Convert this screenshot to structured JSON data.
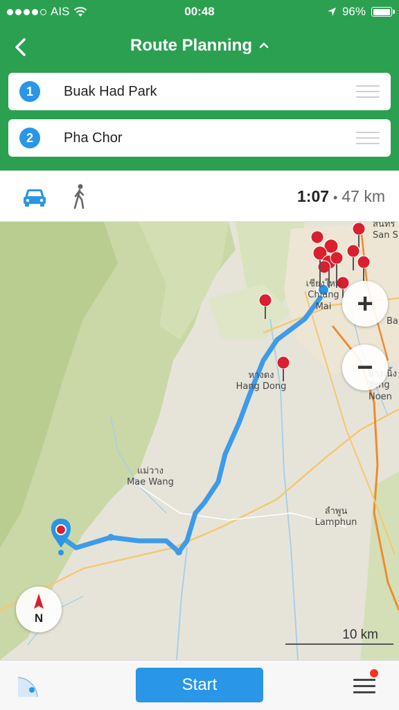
{
  "status_bar": {
    "carrier": "AIS",
    "time": "00:48",
    "battery": "96%",
    "battery_level": 0.96,
    "signal_bars": 4
  },
  "header": {
    "title": "Route Planning",
    "back_icon": "chevron-left-icon",
    "title_icon": "chevron-up-icon"
  },
  "stops": [
    {
      "number": "1",
      "name": "Buak Had Park"
    },
    {
      "number": "2",
      "name": "Pha Chor"
    }
  ],
  "transport": {
    "modes": [
      "car-icon",
      "walk-icon"
    ],
    "selected_mode": "car",
    "duration": "1:07",
    "separator": "•",
    "distance": "47 km"
  },
  "map": {
    "labels": {
      "chiang_mai_th": "เชียงใหม่",
      "chiang_mai": "Chiang Mai",
      "hang_dong_th": "หางดง",
      "hang_dong": "Hang Dong",
      "mae_wang_th": "แม่วาง",
      "mae_wang": "Mae Wang",
      "lamphun_th": "ลำพูน",
      "lamphun": "Lamphun",
      "san_sai_th": "สันทร",
      "san_sai": "San S",
      "ba": "Ba",
      "yang_noeng_th": "ยางเนิ้ง",
      "yang_noeng": "Yang Noen"
    },
    "zoom_in": "+",
    "zoom_out": "−",
    "compass": "N",
    "scale": "10 km"
  },
  "colors": {
    "header_green": "#2ca051",
    "accent_blue": "#2996e8",
    "route_blue": "#3d9be9",
    "pin_red": "#d8202e",
    "badge_red": "#f0361c"
  },
  "bottom_bar": {
    "start_label": "Start",
    "locate_icon": "locate-icon",
    "menu_icon": "menu-icon"
  }
}
